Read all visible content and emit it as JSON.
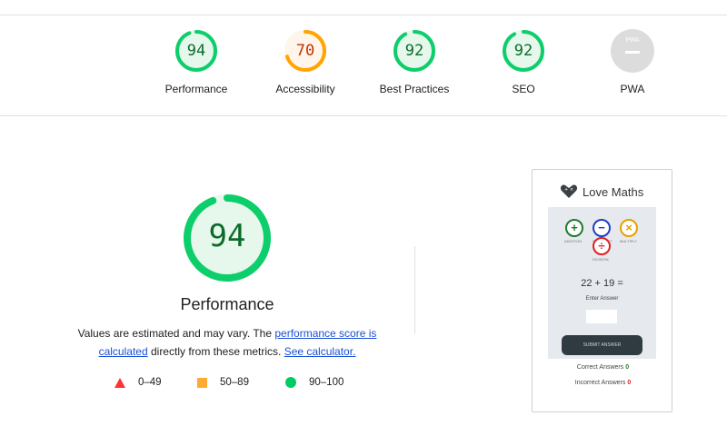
{
  "categories": [
    {
      "label": "Performance",
      "score": "94",
      "value": 94,
      "status": "pass"
    },
    {
      "label": "Accessibility",
      "score": "70",
      "value": 70,
      "status": "average"
    },
    {
      "label": "Best Practices",
      "score": "92",
      "value": 92,
      "status": "pass"
    },
    {
      "label": "SEO",
      "score": "92",
      "value": 92,
      "status": "pass"
    },
    {
      "label": "PWA",
      "score": "—",
      "badge_text": "PWA",
      "status": "na"
    }
  ],
  "main": {
    "score": "94",
    "value": 94,
    "title": "Performance",
    "desc_prefix": "Values are estimated and may vary. The ",
    "desc_link": "performance score is calculated",
    "desc_middle": " directly from these metrics. ",
    "desc_link2": "See calculator."
  },
  "legend": [
    {
      "shape": "triangle",
      "range": "0–49",
      "color": "#ff3333"
    },
    {
      "shape": "square",
      "range": "50–89",
      "color": "#ffaa33"
    },
    {
      "shape": "circle",
      "range": "90–100",
      "color": "#00cc66"
    }
  ],
  "colors": {
    "pass": "#0cce6b",
    "pass_text": "#0c6b2a",
    "pass_fill": "#e6f7ec",
    "average": "#ffa400",
    "average_text": "#c33300",
    "average_fill": "#fff5ea",
    "na": "#dcdcdc"
  },
  "thumbnail": {
    "brand": "Love Maths",
    "ops": [
      {
        "symbol": "+",
        "label": "ADDITION",
        "color": "#1e7a2e"
      },
      {
        "symbol": "−",
        "label": "SUBTRACT",
        "color": "#1f3fc4"
      },
      {
        "symbol": "×",
        "label": "MULTIPLY",
        "color": "#e6a000"
      },
      {
        "symbol": "÷",
        "label": "DIVISION",
        "color": "#e02020"
      }
    ],
    "equation": "22 + 19 =",
    "enter_answer": "Enter Answer",
    "submit": "SUBMIT ANSWER",
    "correct_label": "Correct Answers",
    "correct_value": "0",
    "incorrect_label": "Incorrect Answers",
    "incorrect_value": "0"
  }
}
